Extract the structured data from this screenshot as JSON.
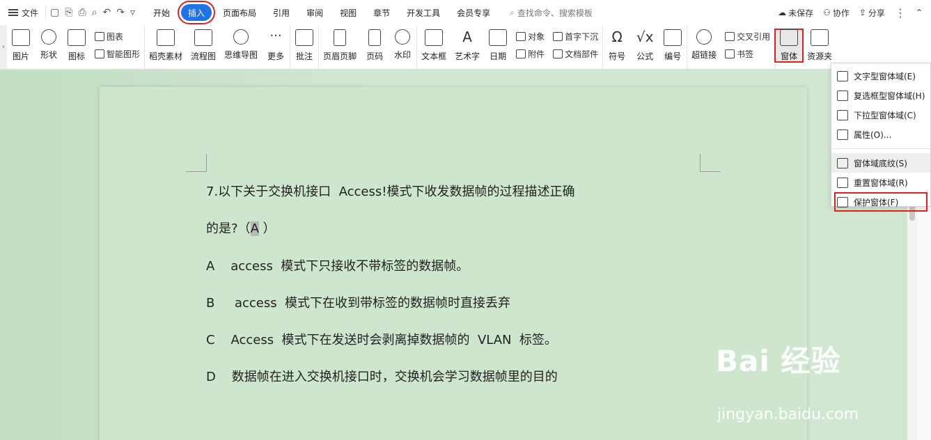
{
  "menubar": {
    "file_label": "文件",
    "tabs": [
      "开始",
      "插入",
      "页面布局",
      "引用",
      "审阅",
      "视图",
      "章节",
      "开发工具",
      "会员专享"
    ],
    "active_tab": "插入",
    "search_placeholder": "查找命令、搜索模板",
    "unsaved": "未保存",
    "collab": "协作",
    "share": "分享"
  },
  "ribbon": {
    "picture": "图片",
    "shape": "形状",
    "icon": "图标",
    "chart": "图表",
    "smart_shape": "智能图形",
    "daoke": "稻壳素材",
    "flowchart": "流程图",
    "mindmap": "思维导图",
    "more": "更多",
    "comment": "批注",
    "header_footer": "页眉页脚",
    "page_num": "页码",
    "watermark": "水印",
    "textbox": "文本框",
    "wordart": "艺术字",
    "date": "日期",
    "object": "对象",
    "attachment": "附件",
    "dropcap": "首字下沉",
    "doc_parts": "文档部件",
    "symbol": "符号",
    "formula": "公式",
    "numbering": "编号",
    "hyperlink": "超链接",
    "crossref": "交叉引用",
    "bookmark": "书签",
    "form": "窗体",
    "resource": "资源夹"
  },
  "dropdown": {
    "items": [
      "文字型窗体域(E)",
      "复选框型窗体域(H)",
      "下拉型窗体域(C)",
      "属性(O)...",
      "窗体域底纹(S)",
      "重置窗体域(R)",
      "保护窗体(F)"
    ]
  },
  "document": {
    "line1": "7.以下关于交换机接口  Access!模式下收发数据帧的过程描述正确",
    "line2_pre": "的是?（",
    "line2_ans": "A",
    "line2_post": " ）",
    "optA": "A    access  模式下只接收不带标签的数据帧。",
    "optB": "B     access  模式下在收到带标签的数据帧时直接丢弃",
    "optC": "C    Access  模式下在发送时会剥离掉数据帧的  VLAN  标签。",
    "optD": "D    数据帧在进入交换机接口时，交换机会学习数据帧里的目的"
  },
  "watermark": {
    "brand": "Bai 经验",
    "url": "jingyan.baidu.com"
  }
}
